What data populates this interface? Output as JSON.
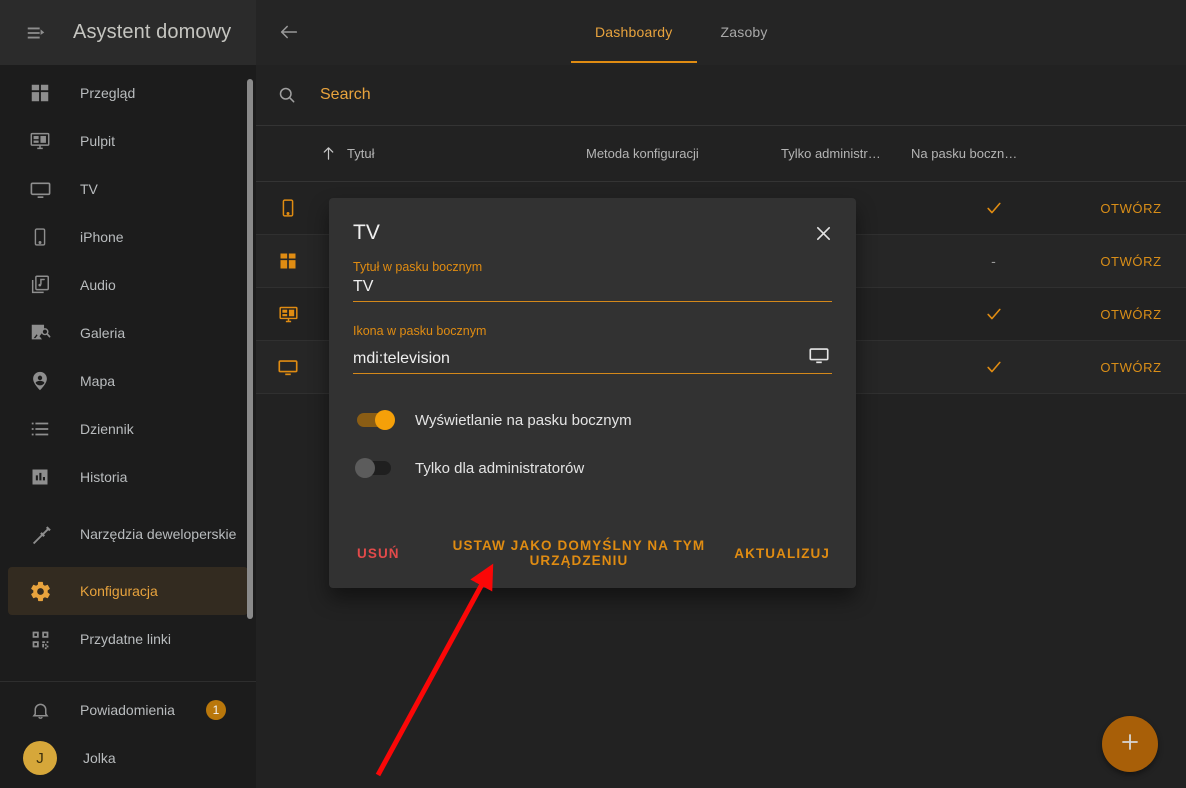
{
  "sidebar": {
    "title": "Asystent domowy",
    "menu_icon": "hamburger-collapse-icon",
    "items": [
      {
        "label": "Przegląd",
        "icon": "view-dashboard-icon",
        "active": false
      },
      {
        "label": "Pulpit",
        "icon": "desktop-dashboard-icon",
        "active": false
      },
      {
        "label": "TV",
        "icon": "television-icon",
        "active": false
      },
      {
        "label": "iPhone",
        "icon": "cellphone-icon",
        "active": false
      },
      {
        "label": "Audio",
        "icon": "music-box-multiple-icon",
        "active": false
      },
      {
        "label": "Galeria",
        "icon": "image-search-icon",
        "active": false
      },
      {
        "label": "Mapa",
        "icon": "map-marker-account-icon",
        "active": false
      },
      {
        "label": "Dziennik",
        "icon": "format-list-bulleted-icon",
        "active": false
      },
      {
        "label": "Historia",
        "icon": "chart-box-icon",
        "active": false
      },
      {
        "label": "Narzędzia deweloperskie",
        "icon": "hammer-icon",
        "active": false
      },
      {
        "label": "Konfiguracja",
        "icon": "cog-icon",
        "active": true
      },
      {
        "label": "Przydatne linki",
        "icon": "qrcode-icon",
        "active": false
      }
    ],
    "notifications": {
      "label": "Powiadomienia",
      "icon": "bell-icon",
      "badge": "1"
    },
    "user": {
      "label": "Jolka",
      "initial": "J"
    }
  },
  "header": {
    "back_icon": "arrow-left-icon",
    "tabs": [
      {
        "label": "Dashboardy",
        "active": true
      },
      {
        "label": "Zasoby",
        "active": false
      }
    ]
  },
  "search": {
    "icon": "search-icon",
    "placeholder": "Search",
    "value": ""
  },
  "table": {
    "columns": {
      "title": "Tytuł",
      "sort_icon": "arrow-up-icon",
      "method": "Metoda konfiguracji",
      "admin": "Tylko administr…",
      "sidebar": "Na pasku boczn…",
      "action": ""
    },
    "rows": [
      {
        "icon": "cellphone-icon",
        "title": "",
        "method": "",
        "admin": "-",
        "sidebar": "✓",
        "sidebar_is_check": true,
        "action": "OTWÓRZ"
      },
      {
        "icon": "view-dashboard-icon",
        "title": "",
        "method": "",
        "admin": "-",
        "sidebar": "-",
        "sidebar_is_check": false,
        "action": "OTWÓRZ"
      },
      {
        "icon": "desktop-dashboard-icon",
        "title": "",
        "method": "",
        "admin": "-",
        "sidebar": "✓",
        "sidebar_is_check": true,
        "action": "OTWÓRZ"
      },
      {
        "icon": "television-icon",
        "title": "",
        "method": "",
        "admin": "-",
        "sidebar": "✓",
        "sidebar_is_check": true,
        "action": "OTWÓRZ"
      }
    ]
  },
  "fab": {
    "icon": "plus-icon",
    "label": "+"
  },
  "dialog": {
    "title": "TV",
    "close_icon": "close-icon",
    "fields": [
      {
        "label": "Tytuł w pasku bocznym",
        "value": "TV",
        "icon": null
      },
      {
        "label": "Ikona w pasku bocznym",
        "value": "mdi:television",
        "icon": "television-icon"
      }
    ],
    "toggles": [
      {
        "label": "Wyświetlanie na pasku bocznym",
        "on": true
      },
      {
        "label": "Tylko dla administratorów",
        "on": false
      }
    ],
    "buttons": {
      "delete": "USUŃ",
      "set_default": "USTAW JAKO DOMYŚLNY NA TYM URZĄDZENIU",
      "update": "AKTUALIZUJ"
    }
  },
  "annotation": {
    "arrow_color": "#fb0707"
  },
  "colors": {
    "accent": "#e08c12",
    "sidebar_bg": "#1c1c1c",
    "main_bg": "#222222",
    "dialog_bg": "#323232",
    "danger": "#e24a4a"
  }
}
